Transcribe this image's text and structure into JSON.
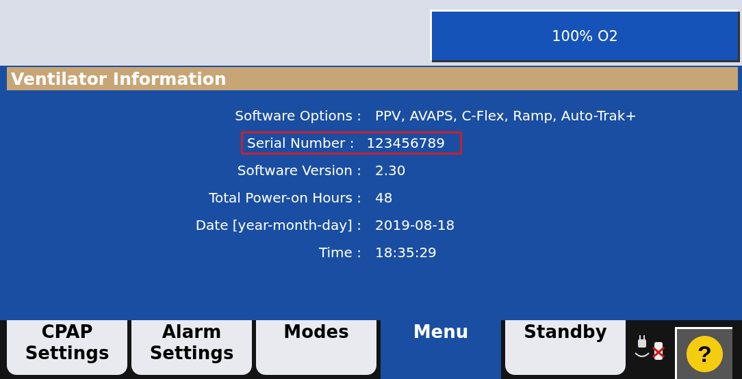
{
  "oxygen_button": {
    "label": "100% O2"
  },
  "header": {
    "title": "Ventilator Information"
  },
  "info_rows": [
    {
      "label": "Software Options :",
      "value": "PPV, AVAPS, C-Flex, Ramp, Auto-Trak+",
      "highlighted": false
    },
    {
      "label": "Serial Number :",
      "value": "123456789",
      "highlighted": true
    },
    {
      "label": "Software Version :",
      "value": "2.30",
      "highlighted": false
    },
    {
      "label": "Total Power-on Hours :",
      "value": "48",
      "highlighted": false
    },
    {
      "label": "Date [year-month-day] :",
      "value": "2019-08-18",
      "highlighted": false
    },
    {
      "label": "Time :",
      "value": "18:35:29",
      "highlighted": false
    }
  ],
  "tabs": [
    {
      "label": "CPAP Settings",
      "selected": false
    },
    {
      "label": "Alarm Settings",
      "selected": false
    },
    {
      "label": "Modes",
      "selected": false
    },
    {
      "label": "Menu",
      "selected": true
    },
    {
      "label": "Standby",
      "selected": false
    }
  ],
  "help_button": {
    "label": "?"
  }
}
